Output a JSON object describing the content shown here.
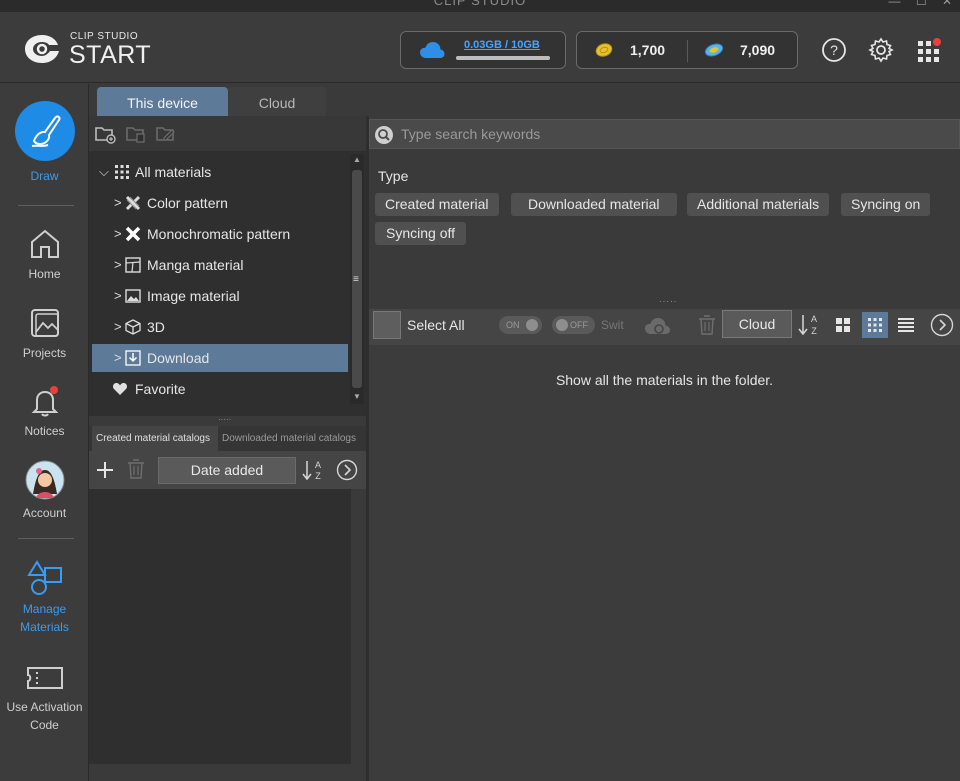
{
  "window": {
    "title": "CLIP STUDIO",
    "controls": "— ☐ ✕"
  },
  "header": {
    "logo_small": "CLIP STUDIO",
    "logo_big": "START",
    "storage_amount": "0.03GB / 10GB",
    "storage_used_fraction": 0.003,
    "gold_coins": "1,700",
    "clippy": "7,090"
  },
  "nav": {
    "draw": "Draw",
    "home": "Home",
    "projects": "Projects",
    "notices": "Notices",
    "account": "Account",
    "manage_materials_1": "Manage",
    "manage_materials_2": "Materials",
    "activation_1": "Use Activation",
    "activation_2": "Code"
  },
  "tabs": {
    "device": "This device",
    "cloud": "Cloud"
  },
  "tree": {
    "all": "All materials",
    "color_pattern": "Color pattern",
    "mono_pattern": "Monochromatic pattern",
    "manga": "Manga material",
    "image": "Image material",
    "three_d": "3D",
    "download": "Download",
    "favorite": "Favorite"
  },
  "catalogs": {
    "created": "Created material catalogs",
    "downloaded": "Downloaded material catalogs",
    "sort": "Date added"
  },
  "search": {
    "placeholder": "Type search keywords"
  },
  "type_filter": {
    "label": "Type",
    "chips": [
      "Created material",
      "Downloaded material",
      "Additional materials",
      "Syncing on",
      "Syncing off"
    ]
  },
  "toolbar": {
    "select_all": "Select All",
    "on_label": "ON",
    "off_label": "OFF",
    "switch_label": "Swit",
    "cloud": "Cloud"
  },
  "content": {
    "message": "Show all the materials in the folder."
  },
  "colors": {
    "accent": "#1e8be6",
    "selected": "#5d7a99",
    "notice_dot": "#e8413c"
  }
}
